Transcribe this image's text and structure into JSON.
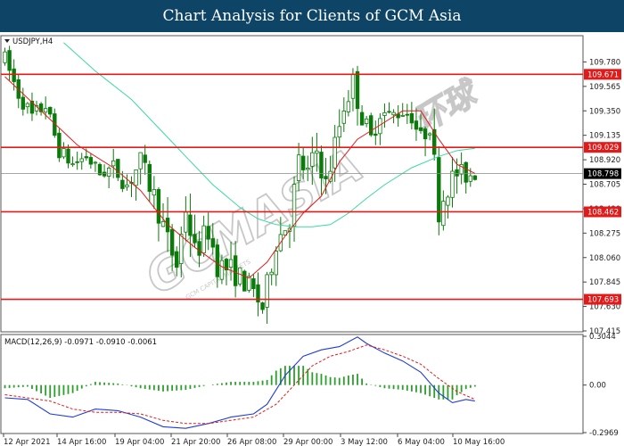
{
  "header": {
    "title": "Chart Analysis for Clients of GCM Asia"
  },
  "watermark": {
    "text": "GCMASIA",
    "subtext": "GCM CAPITAL MARKETS",
    "tail": "环球"
  },
  "colors": {
    "title_bg": "#0e4466",
    "level_line": "#e31a1a",
    "ma_fast": "#e31a1a",
    "ma_slow": "#3cd9a0",
    "candle": "#0a7a0a",
    "macd_line": "#1f3dd6",
    "macd_signal": "#e31a1a",
    "macd_hist": "#2aa02a",
    "current_price_bg": "#000000"
  },
  "chart_data": [
    {
      "type": "candlestick",
      "symbol_label": "USDJPY,H4",
      "ylim": [
        107.415,
        109.995
      ],
      "y_ticks": [
        "109.780",
        "109.565",
        "109.350",
        "109.135",
        "108.920",
        "108.705",
        "108.490",
        "108.275",
        "108.060",
        "107.845",
        "107.630",
        "107.415"
      ],
      "x_ticks": [
        "12 Apr 2021",
        "14 Apr 16:00",
        "19 Apr 04:00",
        "21 Apr 20:00",
        "26 Apr 08:00",
        "29 Apr 00:00",
        "3 May 12:00",
        "6 May 04:00",
        "10 May 16:00"
      ],
      "horizontal_levels": [
        "109.671",
        "109.029",
        "108.462",
        "107.693"
      ],
      "current_price": "108.798",
      "close_path": [
        [
          0,
          109.8
        ],
        [
          3,
          109.5
        ],
        [
          6,
          109.3
        ],
        [
          9,
          109.4
        ],
        [
          12,
          109.0
        ],
        [
          15,
          108.88
        ],
        [
          18,
          108.95
        ],
        [
          21,
          108.8
        ],
        [
          24,
          108.85
        ],
        [
          27,
          108.7
        ],
        [
          30,
          108.9
        ],
        [
          33,
          108.6
        ],
        [
          36,
          108.2
        ],
        [
          38,
          108.0
        ],
        [
          40,
          108.5
        ],
        [
          42,
          108.1
        ],
        [
          45,
          108.3
        ],
        [
          47,
          108.0
        ],
        [
          50,
          107.95
        ],
        [
          53,
          107.85
        ],
        [
          55,
          107.75
        ],
        [
          57,
          107.62
        ],
        [
          60,
          108.2
        ],
        [
          63,
          108.4
        ],
        [
          65,
          108.9
        ],
        [
          67,
          108.8
        ],
        [
          69,
          109.0
        ],
        [
          71,
          108.7
        ],
        [
          73,
          109.05
        ],
        [
          75,
          109.4
        ],
        [
          77,
          109.6
        ],
        [
          79,
          109.3
        ],
        [
          81,
          109.1
        ],
        [
          83,
          109.35
        ],
        [
          85,
          109.3
        ],
        [
          88,
          109.35
        ],
        [
          90,
          109.3
        ],
        [
          92,
          109.1
        ],
        [
          94,
          109.25
        ],
        [
          96,
          108.5
        ],
        [
          98,
          108.7
        ],
        [
          100,
          108.8
        ],
        [
          102,
          108.78
        ],
        [
          104,
          108.8
        ]
      ],
      "volatility": [
        [
          0,
          0.18
        ],
        [
          20,
          0.14
        ],
        [
          38,
          0.28
        ],
        [
          60,
          0.22
        ],
        [
          75,
          0.25
        ],
        [
          90,
          0.16
        ],
        [
          96,
          0.3
        ],
        [
          104,
          0.16
        ]
      ],
      "ma_fast": [
        [
          0,
          109.65
        ],
        [
          8,
          109.35
        ],
        [
          16,
          109.05
        ],
        [
          24,
          108.85
        ],
        [
          30,
          108.65
        ],
        [
          36,
          108.35
        ],
        [
          42,
          108.15
        ],
        [
          48,
          107.98
        ],
        [
          54,
          107.88
        ],
        [
          58,
          108.02
        ],
        [
          62,
          108.25
        ],
        [
          66,
          108.45
        ],
        [
          70,
          108.6
        ],
        [
          74,
          108.9
        ],
        [
          78,
          109.1
        ],
        [
          84,
          109.25
        ],
        [
          88,
          109.35
        ],
        [
          92,
          109.35
        ],
        [
          96,
          109.1
        ],
        [
          100,
          108.88
        ],
        [
          104,
          108.8
        ]
      ],
      "ma_slow": [
        [
          13,
          109.95
        ],
        [
          20,
          109.7
        ],
        [
          28,
          109.45
        ],
        [
          34,
          109.2
        ],
        [
          40,
          108.95
        ],
        [
          46,
          108.7
        ],
        [
          52,
          108.5
        ],
        [
          56,
          108.4
        ],
        [
          60,
          108.35
        ],
        [
          64,
          108.33
        ],
        [
          68,
          108.33
        ],
        [
          72,
          108.35
        ],
        [
          76,
          108.45
        ],
        [
          80,
          108.58
        ],
        [
          84,
          108.7
        ],
        [
          90,
          108.85
        ],
        [
          96,
          108.95
        ],
        [
          100,
          109.0
        ],
        [
          104,
          109.02
        ]
      ]
    },
    {
      "type": "macd",
      "label": "MACD(12,26,9) -0.0971 -0.0910 -0.0061",
      "ylim": [
        -0.2969,
        0.3044
      ],
      "y_ticks": [
        "0.3044",
        "0.00",
        "-0.2969"
      ],
      "macd_line": [
        [
          0,
          -0.08
        ],
        [
          5,
          -0.09
        ],
        [
          10,
          -0.18
        ],
        [
          15,
          -0.2
        ],
        [
          20,
          -0.15
        ],
        [
          25,
          -0.16
        ],
        [
          30,
          -0.2
        ],
        [
          35,
          -0.26
        ],
        [
          40,
          -0.27
        ],
        [
          45,
          -0.24
        ],
        [
          50,
          -0.2
        ],
        [
          55,
          -0.18
        ],
        [
          58,
          -0.12
        ],
        [
          62,
          0.06
        ],
        [
          66,
          0.18
        ],
        [
          70,
          0.22
        ],
        [
          74,
          0.24
        ],
        [
          78,
          0.3
        ],
        [
          80,
          0.26
        ],
        [
          84,
          0.2
        ],
        [
          88,
          0.15
        ],
        [
          92,
          0.08
        ],
        [
          96,
          -0.05
        ],
        [
          99,
          -0.11
        ],
        [
          102,
          -0.09
        ],
        [
          104,
          -0.1
        ]
      ],
      "signal_line": [
        [
          0,
          -0.06
        ],
        [
          10,
          -0.1
        ],
        [
          15,
          -0.15
        ],
        [
          20,
          -0.17
        ],
        [
          25,
          -0.17
        ],
        [
          30,
          -0.18
        ],
        [
          35,
          -0.22
        ],
        [
          40,
          -0.24
        ],
        [
          45,
          -0.24
        ],
        [
          50,
          -0.22
        ],
        [
          55,
          -0.2
        ],
        [
          60,
          -0.12
        ],
        [
          64,
          0.0
        ],
        [
          68,
          0.12
        ],
        [
          72,
          0.18
        ],
        [
          76,
          0.21
        ],
        [
          80,
          0.25
        ],
        [
          84,
          0.22
        ],
        [
          88,
          0.18
        ],
        [
          92,
          0.13
        ],
        [
          96,
          0.04
        ],
        [
          100,
          -0.04
        ],
        [
          104,
          -0.09
        ]
      ]
    }
  ]
}
